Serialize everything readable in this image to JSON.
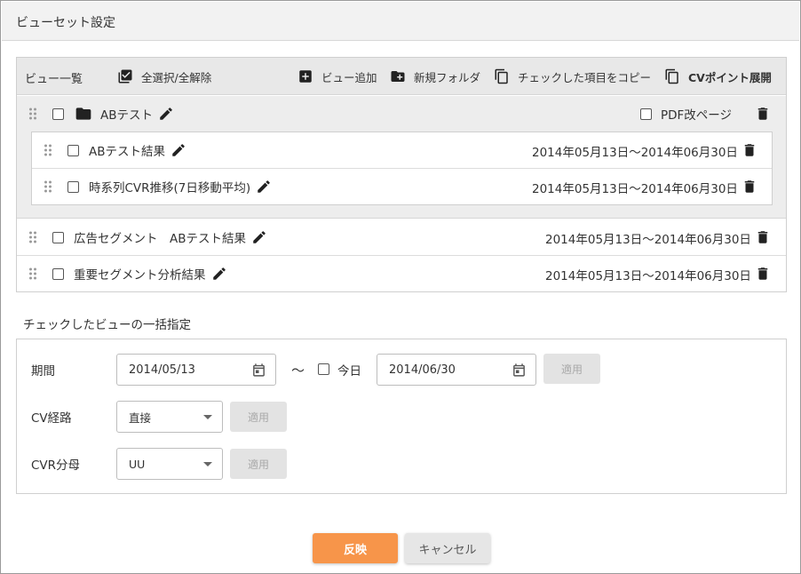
{
  "dialog": {
    "title": "ビューセット設定"
  },
  "toolbar": {
    "title": "ビュー一覧",
    "select_all": "全選択/全解除",
    "add_view": "ビュー追加",
    "new_folder": "新規フォルダ",
    "copy_checked": "チェックした項目をコピー",
    "cv_expand": "CVポイント展開"
  },
  "folder": {
    "name": "ABテスト",
    "pdf_page_break": "PDF改ページ",
    "items": [
      {
        "name": "ABテスト結果",
        "period": "2014年05月13日〜2014年06月30日"
      },
      {
        "name": "時系列CVR推移(7日移動平均)",
        "period": "2014年05月13日〜2014年06月30日"
      }
    ]
  },
  "views": [
    {
      "name": "広告セグメント　ABテスト結果",
      "period": "2014年05月13日〜2014年06月30日"
    },
    {
      "name": "重要セグメント分析結果",
      "period": "2014年05月13日〜2014年06月30日"
    }
  ],
  "batch": {
    "title": "チェックしたビューの一括指定",
    "period_label": "期間",
    "start_date": "2014/05/13",
    "tilde": "〜",
    "today_label": "今日",
    "end_date": "2014/06/30",
    "apply": "適用",
    "cv_route_label": "CV経路",
    "cv_route_value": "直接",
    "cvr_denominator_label": "CVR分母",
    "cvr_denominator_value": "UU"
  },
  "footer": {
    "apply_label": "反映",
    "cancel_label": "キャンセル"
  },
  "colors": {
    "primary": "#f7954a",
    "disabled": "#e3e3e3",
    "toolbar_bg": "#e8e8e8"
  },
  "icons": [
    "checkbox-checked-icon",
    "add-box-icon",
    "create-folder-icon",
    "copy-icon",
    "drag-handle-icon",
    "folder-icon",
    "pencil-icon",
    "trash-icon",
    "calendar-icon",
    "dropdown-arrow-icon"
  ]
}
